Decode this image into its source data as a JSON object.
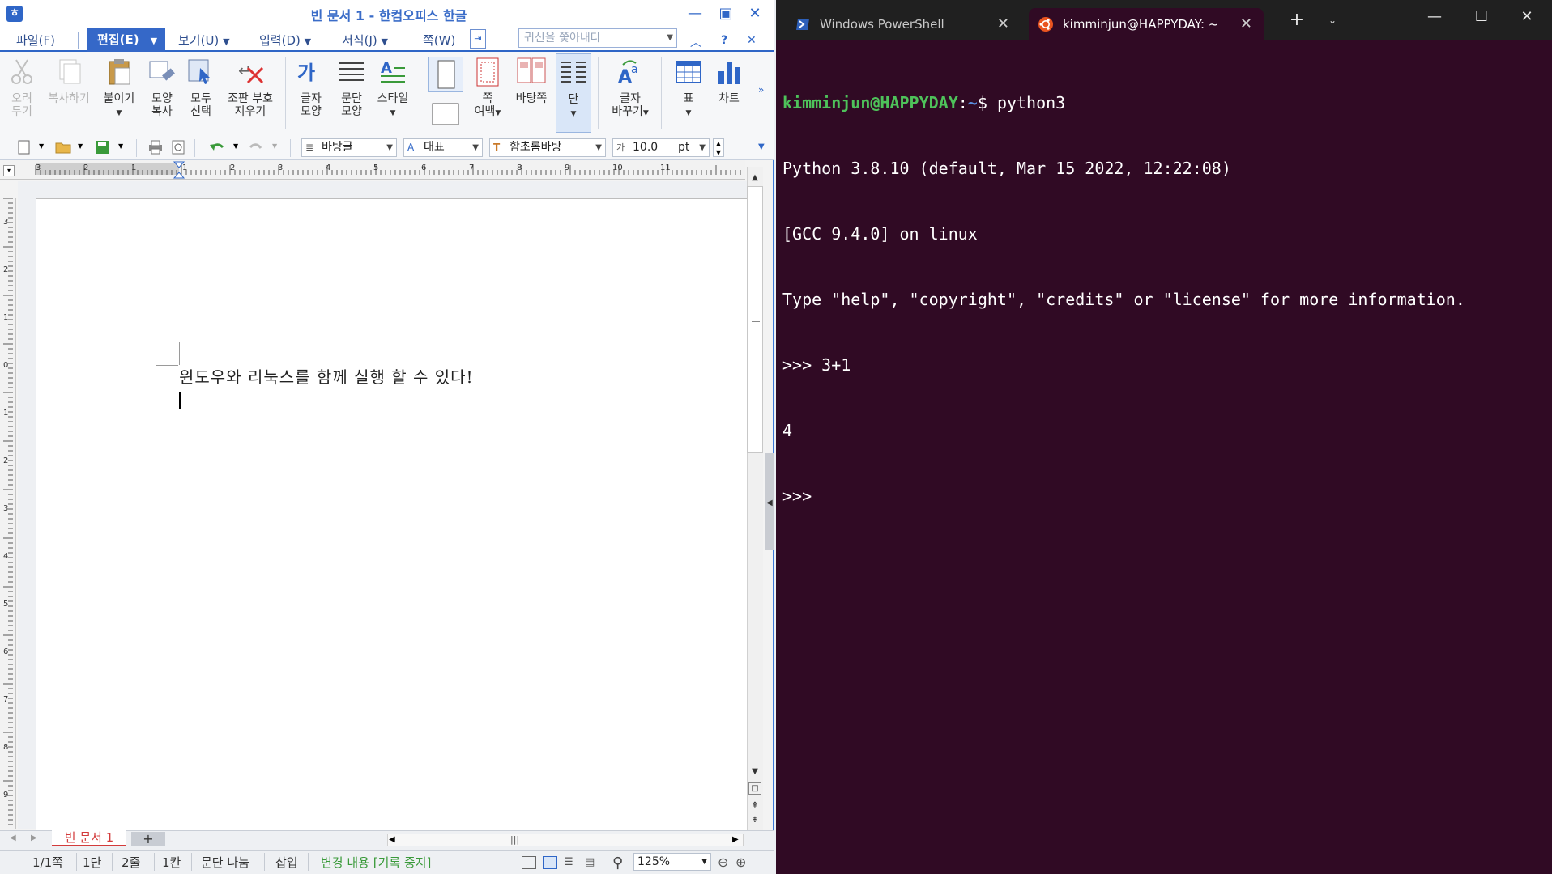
{
  "hwp": {
    "title": "빈 문서 1 - 한컴오피스 한글",
    "menu": {
      "file": "파일(F)",
      "edit": "편집(E)",
      "view": "보기(U)",
      "input": "입력(D)",
      "format": "서식(J)",
      "page": "쪽(W)",
      "search_placeholder": "귀신을 쫓아내다"
    },
    "ribbon": {
      "cut": [
        "오려",
        "두기"
      ],
      "copy": "복사하기",
      "paste": "붙이기",
      "format_copy": [
        "모양",
        "복사"
      ],
      "select_all": [
        "모두",
        "선택"
      ],
      "clear_marks": [
        "조판 부호",
        "지우기"
      ],
      "char_shape": [
        "글자",
        "모양"
      ],
      "para_shape": [
        "문단",
        "모양"
      ],
      "style": "스타일",
      "page_margin": [
        "쪽",
        "여백"
      ],
      "master_page": "바탕쪽",
      "columns": "단",
      "change_char": [
        "글자",
        "바꾸기"
      ],
      "table": "표",
      "chart": "차트"
    },
    "toolbar2": {
      "style_name": "바탕글",
      "lang": "대표",
      "font_name": "함초롬바탕",
      "font_size": "10.0",
      "font_unit": "pt"
    },
    "document": {
      "text": "윈도우와 리눅스를 함께 실행 할 수 있다!"
    },
    "doc_tab": "빈 문서 1",
    "status": {
      "page": "1/1쪽",
      "section": "1단",
      "line": "2줄",
      "column": "1칸",
      "para_break": "문단 나눔",
      "insert_mode": "삽입",
      "track_changes": "변경 내용 [기록 중지]",
      "zoom": "125%"
    },
    "ruler_h_labels": [
      "3",
      "2",
      "1",
      "1",
      "2",
      "3",
      "4",
      "5",
      "6",
      "7",
      "8",
      "9",
      "10",
      "11"
    ],
    "ruler_v_labels": [
      "3",
      "2",
      "1",
      "0",
      "1",
      "2",
      "3",
      "4",
      "5",
      "6",
      "7",
      "8",
      "9"
    ]
  },
  "terminal": {
    "tabs": [
      {
        "label": "Windows PowerShell",
        "icon": "powershell-icon"
      },
      {
        "label": "kimminjun@HAPPYDAY: ~",
        "icon": "ubuntu-icon"
      }
    ],
    "prompt_user": "kimminjun@HAPPYDAY",
    "prompt_path": "~",
    "command": "python3",
    "lines": [
      "Python 3.8.10 (default, Mar 15 2022, 12:22:08)",
      "[GCC 9.4.0] on linux",
      "Type \"help\", \"copyright\", \"credits\" or \"license\" for more information.",
      ">>> 3+1",
      "4",
      ">>> "
    ]
  },
  "colors": {
    "terminal_bg": "#300a24",
    "hwp_accent": "#2f66c7",
    "prompt_green": "#4ec25a",
    "prompt_blue": "#5b8ddd"
  }
}
